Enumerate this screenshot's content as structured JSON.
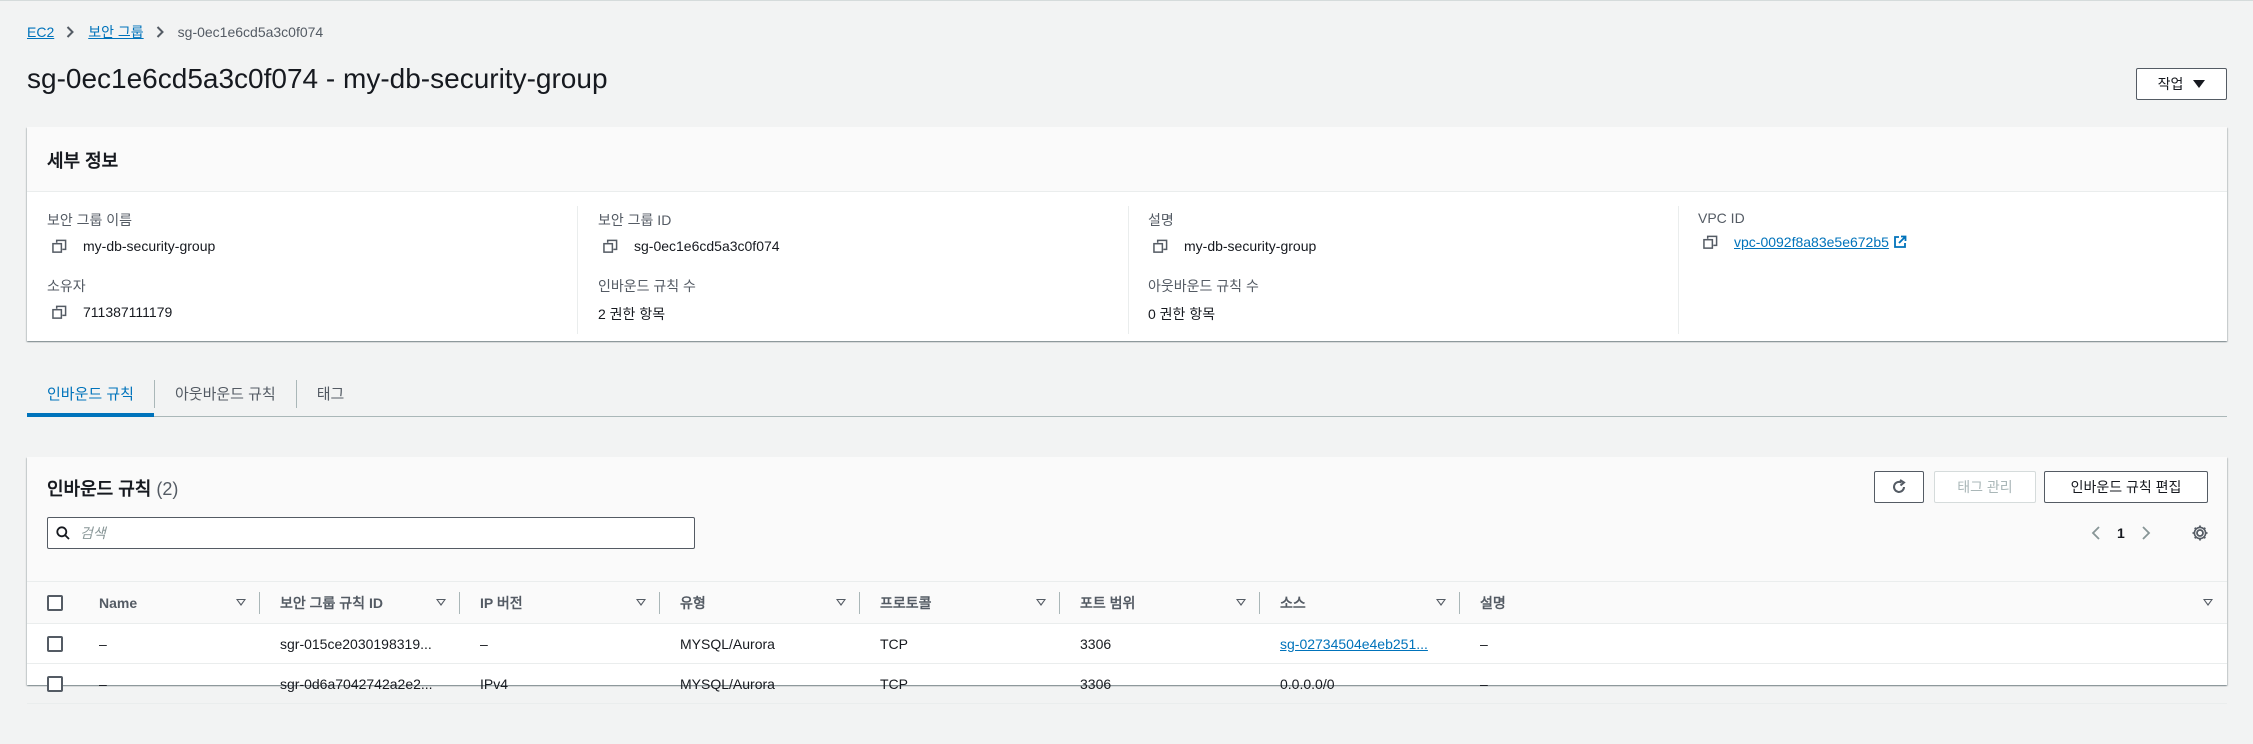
{
  "breadcrumb": {
    "items": [
      "EC2",
      "보안 그룹"
    ],
    "current": "sg-0ec1e6cd5a3c0f074"
  },
  "page": {
    "title": "sg-0ec1e6cd5a3c0f074 - my-db-security-group",
    "actions_label": "작업"
  },
  "details": {
    "header": "세부 정보",
    "fields": {
      "sg_name": {
        "label": "보안 그룹 이름",
        "value": "my-db-security-group"
      },
      "sg_id": {
        "label": "보안 그룹 ID",
        "value": "sg-0ec1e6cd5a3c0f074"
      },
      "description": {
        "label": "설명",
        "value": "my-db-security-group"
      },
      "vpc_id": {
        "label": "VPC ID",
        "value": "vpc-0092f8a83e5e672b5"
      },
      "owner": {
        "label": "소유자",
        "value": "711387111179"
      },
      "inbound_count": {
        "label": "인바운드 규칙 수",
        "value": "2 권한 항목"
      },
      "outbound_count": {
        "label": "아웃바운드 규칙 수",
        "value": "0 권한 항목"
      }
    }
  },
  "tabs": [
    {
      "label": "인바운드 규칙",
      "active": true
    },
    {
      "label": "아웃바운드 규칙",
      "active": false
    },
    {
      "label": "태그",
      "active": false
    }
  ],
  "rules": {
    "title": "인바운드 규칙",
    "count": "(2)",
    "manage_tags_label": "태그 관리",
    "edit_label": "인바운드 규칙 편집",
    "search_placeholder": "검색",
    "page": "1",
    "columns": [
      "Name",
      "보안 그룹 규칙 ID",
      "IP 버전",
      "유형",
      "프로토콜",
      "포트 범위",
      "소스",
      "설명"
    ],
    "rows": [
      {
        "name": "–",
        "rule_id": "sgr-015ce2030198319...",
        "ip_version": "–",
        "type": "MYSQL/Aurora",
        "protocol": "TCP",
        "port": "3306",
        "source": "sg-02734504e4eb251...",
        "source_is_link": true,
        "description": "–"
      },
      {
        "name": "–",
        "rule_id": "sgr-0d6a7042742a2e2...",
        "ip_version": "IPv4",
        "type": "MYSQL/Aurora",
        "protocol": "TCP",
        "port": "3306",
        "source": "0.0.0.0/0",
        "source_is_link": false,
        "description": "–"
      }
    ]
  },
  "colors": {
    "link": "#0073bb",
    "text": "#16191f",
    "muted": "#545b64",
    "background": "#f2f3f3"
  }
}
